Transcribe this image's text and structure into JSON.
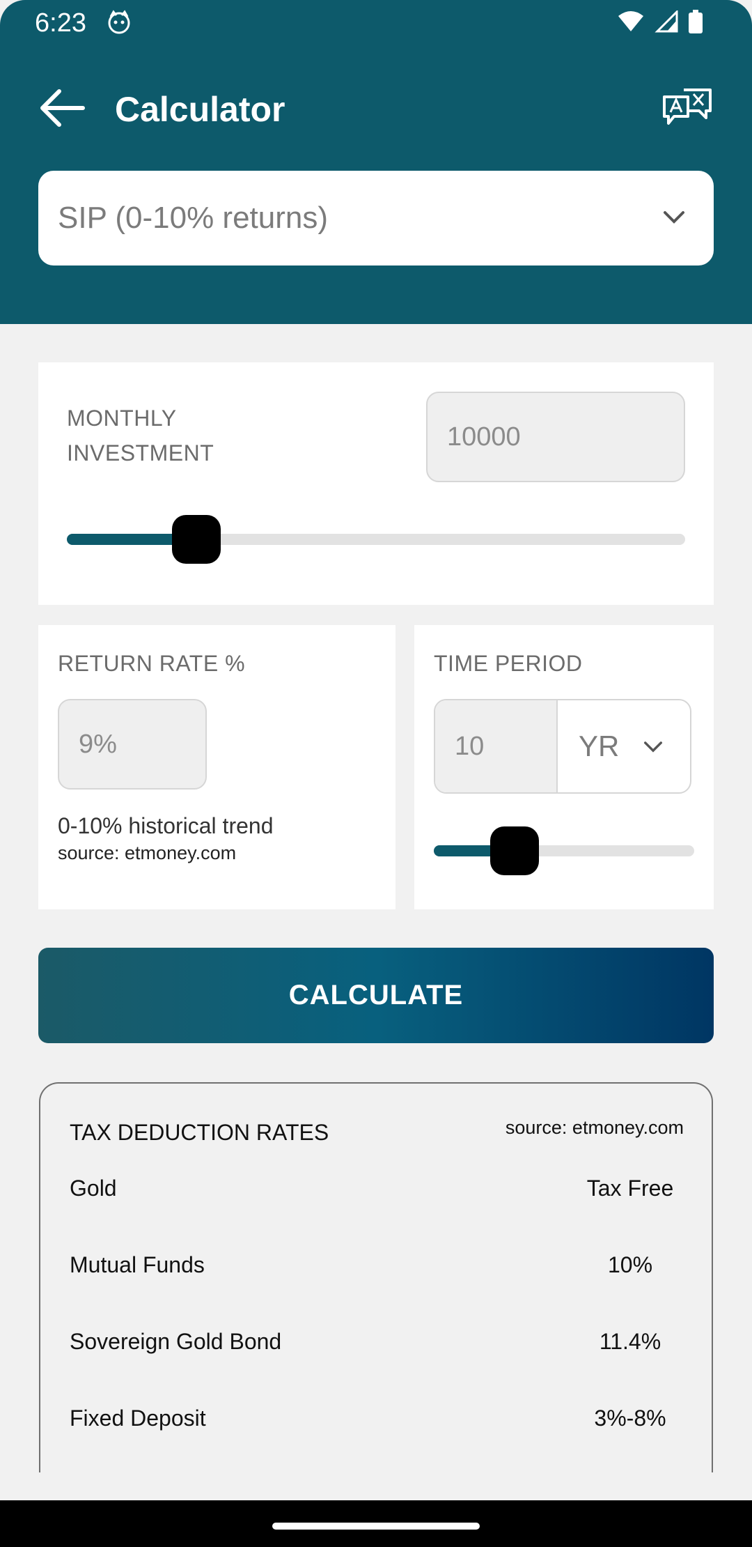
{
  "status_bar": {
    "time": "6:23"
  },
  "header": {
    "title": "Calculator"
  },
  "calculator_type": {
    "selected": "SIP (0-10% returns)"
  },
  "monthly_investment": {
    "label_line1": "MONTHLY",
    "label_line2": "INVESTMENT",
    "value": "10000",
    "slider_fraction": 0.21
  },
  "return_rate": {
    "label": "RETURN RATE %",
    "value": "9%",
    "note": "0-10% historical trend",
    "source": "source: etmoney.com"
  },
  "time_period": {
    "label": "TIME PERIOD",
    "value": "10",
    "unit": "YR",
    "slider_fraction": 0.31
  },
  "calculate_button": {
    "label": "CALCULATE"
  },
  "tax_deduction": {
    "title": "TAX DEDUCTION RATES",
    "source": "source: etmoney.com",
    "rows": [
      {
        "name": "Gold",
        "rate": "Tax Free"
      },
      {
        "name": "Mutual Funds",
        "rate": "10%"
      },
      {
        "name": "Sovereign Gold Bond",
        "rate": "11.4%"
      },
      {
        "name": "Fixed Deposit",
        "rate": "3%-8%"
      }
    ]
  },
  "colors": {
    "primary": "#0d5a6b",
    "background": "#f1f1f1",
    "card": "#ffffff"
  },
  "icons": [
    "back-arrow-icon",
    "translate-icon",
    "chevron-down-icon",
    "wifi-icon",
    "signal-icon",
    "battery-icon",
    "cat-notification-icon"
  ]
}
